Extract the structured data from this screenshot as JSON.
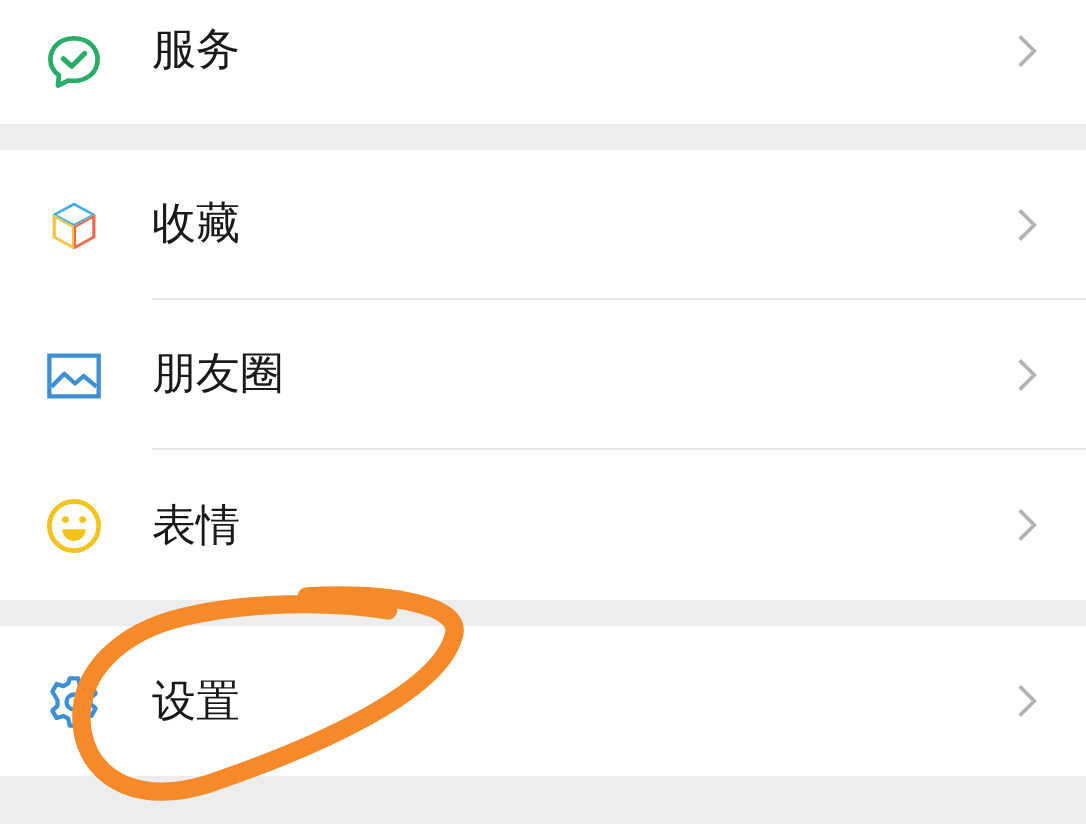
{
  "sections": [
    {
      "items": [
        {
          "label": "服务",
          "kind": "service"
        }
      ]
    },
    {
      "items": [
        {
          "label": "收藏",
          "kind": "favorites"
        },
        {
          "label": "朋友圈",
          "kind": "moments"
        },
        {
          "label": "表情",
          "kind": "stickers"
        }
      ]
    },
    {
      "items": [
        {
          "label": "设置",
          "kind": "settings"
        }
      ]
    }
  ],
  "annotation": {
    "kind": "circle"
  }
}
